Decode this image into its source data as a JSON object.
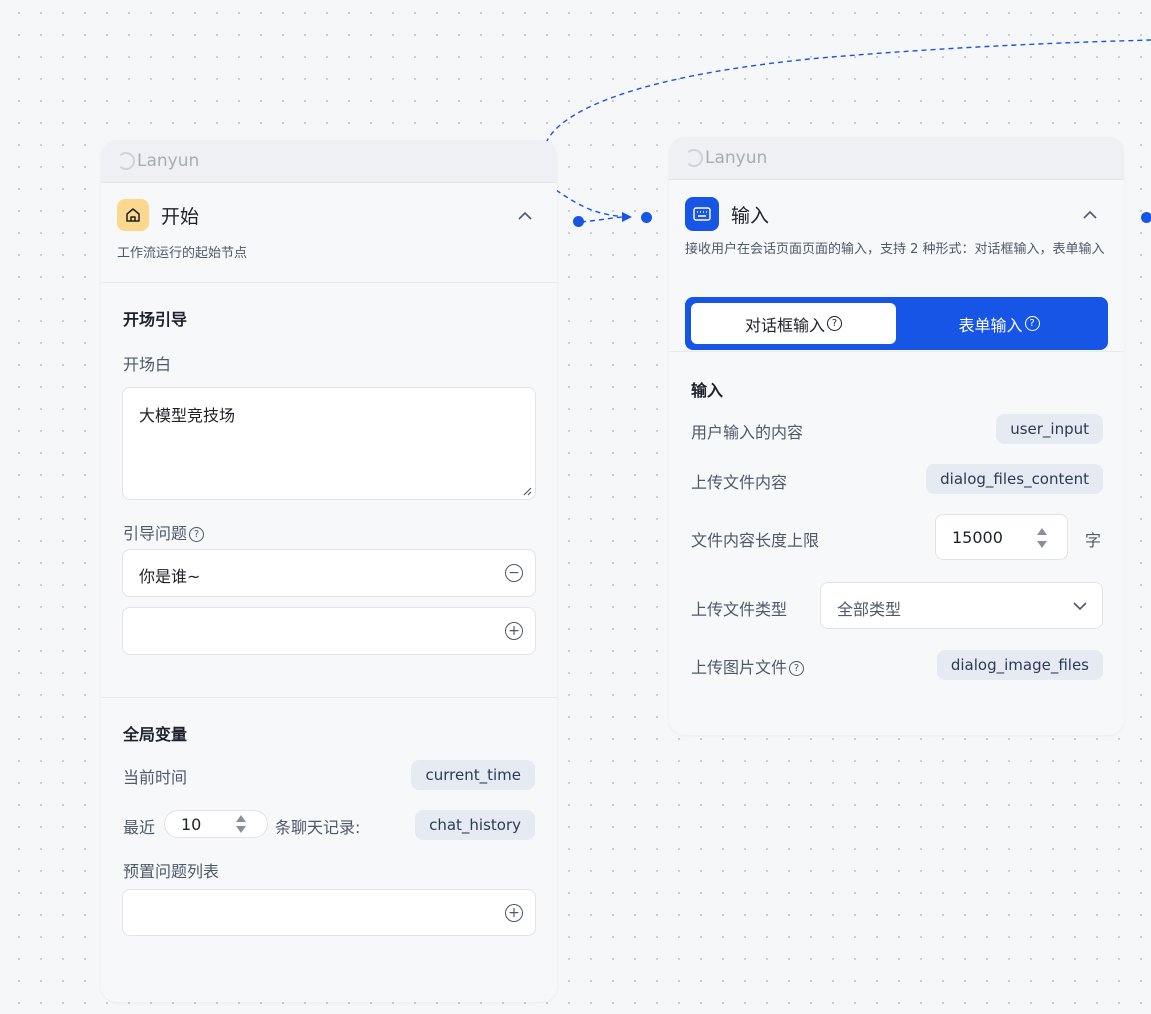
{
  "brand": "Lanyun",
  "start_node": {
    "title": "开始",
    "description": "工作流运行的起始节点",
    "opening_section": {
      "title": "开场引导",
      "opening_label": "开场白",
      "opening_text": "大模型竞技场",
      "guide_label": "引导问题",
      "guide_questions": [
        "你是谁~",
        ""
      ]
    },
    "globals_section": {
      "title": "全局变量",
      "current_time_label": "当前时间",
      "current_time_var": "current_time",
      "recent_prefix": "最近",
      "recent_count": "10",
      "recent_suffix": "条聊天记录:",
      "chat_history_var": "chat_history",
      "preset_label": "预置问题列表"
    }
  },
  "input_node": {
    "title": "输入",
    "description": "接收用户在会话页面页面的输入，支持 2 种形式：对话框输入，表单输入",
    "tabs": [
      {
        "label": "对话框输入",
        "active": true
      },
      {
        "label": "表单输入",
        "active": false
      }
    ],
    "section_title": "输入",
    "rows": {
      "user_input_label": "用户输入的内容",
      "user_input_var": "user_input",
      "files_content_label": "上传文件内容",
      "files_content_var": "dialog_files_content",
      "limit_label": "文件内容长度上限",
      "limit_value": "15000",
      "limit_unit": "字",
      "file_type_label": "上传文件类型",
      "file_type_value": "全部类型",
      "image_files_label": "上传图片文件",
      "image_files_var": "dialog_image_files"
    }
  },
  "icons": {
    "start": "home-icon",
    "input": "keyboard-icon",
    "help": "question-circle-icon",
    "remove": "minus-circle-icon",
    "add": "plus-circle-icon",
    "collapse": "chevron-up-icon",
    "dropdown": "chevron-down-icon",
    "stepper": "stepper-arrows-icon",
    "loading": "spinner-icon"
  },
  "colors": {
    "accent": "#1755e7",
    "start_icon_bg": "#fcd88e",
    "tag_bg": "#e6ebf3",
    "edge": "#1755e7"
  }
}
